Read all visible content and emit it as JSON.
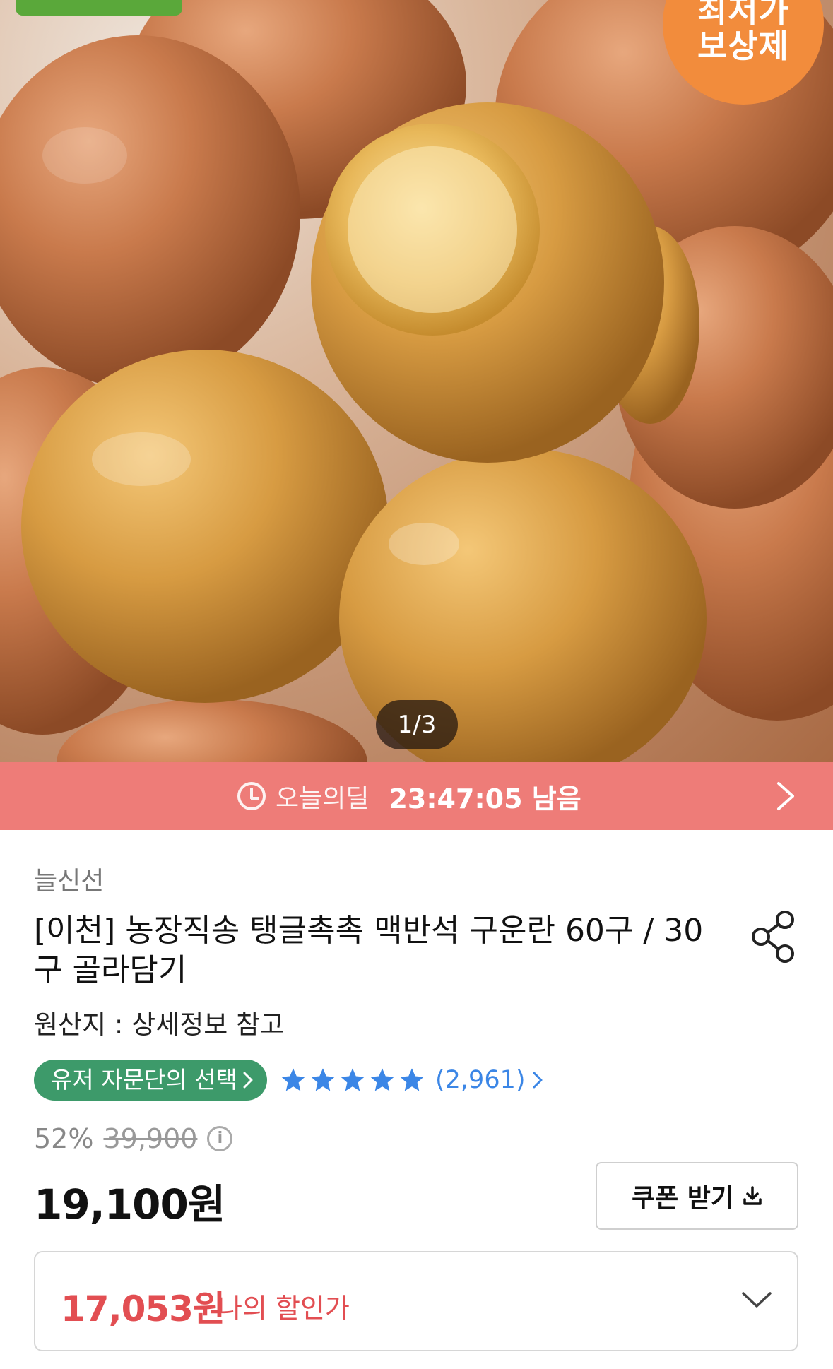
{
  "hero": {
    "badge_line1": "최저가",
    "badge_line2": "보상제",
    "page_indicator": "1/3",
    "current_page": 1,
    "total_pages": 3
  },
  "deal": {
    "label": "오늘의딜",
    "timer": "23:47:05 남음",
    "color": "#ee7c78"
  },
  "product": {
    "seller": "늘신선",
    "title": "[이천] 농장직송 탱글촉촉 맥반석 구운란 60구 / 30구 골라담기",
    "origin": "원산지 : 상세정보 참고",
    "advisor_chip": "유저 자문단의 선택",
    "rating_stars": 5,
    "review_count": "(2,961)",
    "discount_rate": "52%",
    "original_price": "39,900",
    "price": "19,100원",
    "coupon_button": "쿠폰 받기",
    "my_price": "17,053원",
    "my_price_label": "나의 할인가"
  },
  "colors": {
    "accent_green": "#3d9a6a",
    "rating_blue": "#3b86e6",
    "discount_red": "#e24e52",
    "badge_orange": "#f28c3c"
  },
  "icons": [
    "clock-icon",
    "chevron-right-icon",
    "share-icon",
    "star-icon",
    "info-icon",
    "download-icon",
    "chevron-down-icon"
  ]
}
